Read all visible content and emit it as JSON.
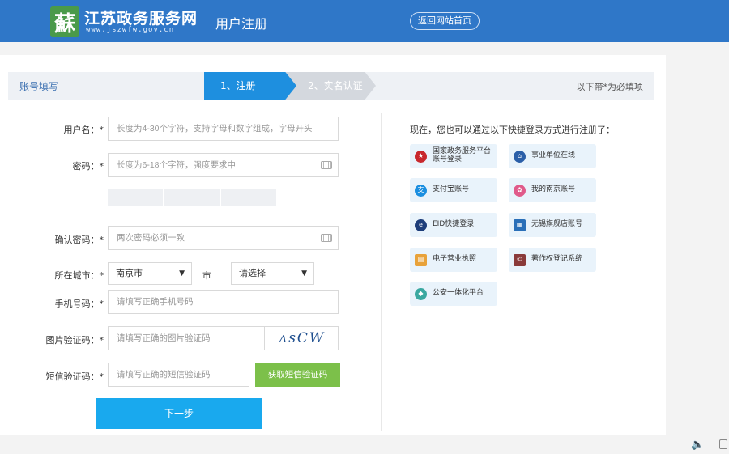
{
  "header": {
    "logo_char": "蘇",
    "site_title": "江苏政务服务网",
    "site_url": "www.jszwfw.gov.cn",
    "page_title": "用户注册",
    "home_button": "返回网站首页"
  },
  "steps": {
    "section_title": "账号填写",
    "step1": "1、注册",
    "step2": "2、实名认证",
    "required_note": "以下带*为必填项"
  },
  "form": {
    "username": {
      "label": "用户名：*",
      "placeholder": "长度为4-30个字符，支持字母和数字组成，字母开头"
    },
    "password": {
      "label": "密码：*",
      "placeholder": "长度为6-18个字符，强度要求中"
    },
    "confirm": {
      "label": "确认密码：*",
      "placeholder": "两次密码必须一致"
    },
    "city": {
      "label": "所在城市：*",
      "value": "南京市",
      "unit": "市",
      "district": "请选择"
    },
    "phone": {
      "label": "手机号码：*",
      "placeholder": "请填写正确手机号码"
    },
    "captcha": {
      "label": "图片验证码：*",
      "placeholder": "请填写正确的图片验证码",
      "image_text": "ᴧsCW"
    },
    "sms": {
      "label": "短信验证码：*",
      "placeholder": "请填写正确的短信验证码",
      "button": "获取短信验证码"
    },
    "next_button": "下一步"
  },
  "quick_login": {
    "intro": "现在，您也可以通过以下快捷登录方式进行注册了：",
    "items": [
      {
        "label": "国家政务服务平台账号登录",
        "icon": "national-emblem-icon",
        "color": "#c8282d"
      },
      {
        "label": "事业单位在线",
        "icon": "institution-icon",
        "color": "#2b5fa8"
      },
      {
        "label": "支付宝账号",
        "icon": "alipay-icon",
        "color": "#1a8ee0"
      },
      {
        "label": "我的南京账号",
        "icon": "my-nanjing-icon",
        "color": "#e05a8a"
      },
      {
        "label": "EID快捷登录",
        "icon": "eid-icon",
        "color": "#1d3d7a"
      },
      {
        "label": "无锡旗舰店账号",
        "icon": "wuxi-icon",
        "color": "#2a6fb8"
      },
      {
        "label": "电子营业执照",
        "icon": "business-license-icon",
        "color": "#e8a23a"
      },
      {
        "label": "著作权登记系统",
        "icon": "copyright-icon",
        "color": "#8a3a3a"
      },
      {
        "label": "公安一体化平台",
        "icon": "police-shield-icon",
        "color": "#3aa8a0"
      }
    ]
  }
}
